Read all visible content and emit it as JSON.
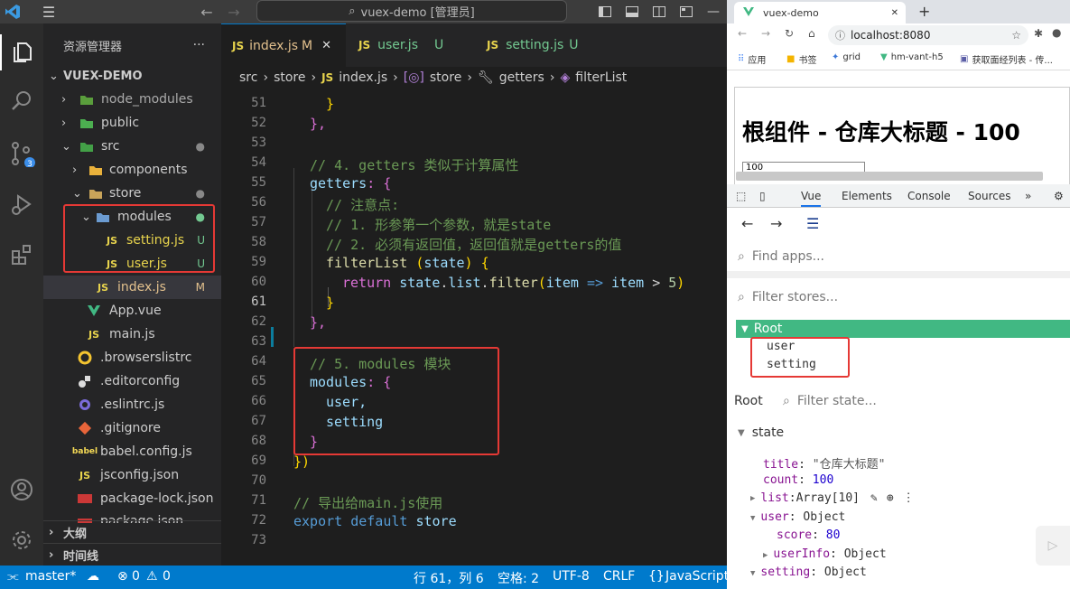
{
  "titlebar": {
    "search_text": "vuex-demo [管理员]"
  },
  "sidebar": {
    "header": "资源管理器",
    "more": "···",
    "root": "VUEX-DEMO",
    "items": [
      {
        "label": "node_modules"
      },
      {
        "label": "public"
      },
      {
        "label": "src"
      },
      {
        "label": "components"
      },
      {
        "label": "store"
      },
      {
        "label": "modules"
      },
      {
        "label": "setting.js",
        "badge": "U",
        "icon_text": "JS"
      },
      {
        "label": "user.js",
        "badge": "U",
        "icon_text": "JS"
      },
      {
        "label": "index.js",
        "badge": "M",
        "icon_text": "JS"
      },
      {
        "label": "App.vue"
      },
      {
        "label": "main.js",
        "icon_text": "JS"
      },
      {
        "label": ".browserslistrc"
      },
      {
        "label": ".editorconfig"
      },
      {
        "label": ".eslintrc.js"
      },
      {
        "label": ".gitignore"
      },
      {
        "label": "babel.config.js",
        "icon_text": "babel"
      },
      {
        "label": "jsconfig.json",
        "icon_text": "JS"
      },
      {
        "label": "package-lock.json"
      },
      {
        "label": "package.json"
      }
    ],
    "outline": "大纲",
    "timeline": "时间线"
  },
  "tabs": [
    {
      "icon_text": "JS",
      "label": "index.js",
      "badge": "M",
      "close": "✕"
    },
    {
      "icon_text": "JS",
      "label": "user.js",
      "badge": "U"
    },
    {
      "icon_text": "JS",
      "label": "setting.js",
      "badge": "U"
    }
  ],
  "breadcrumb": {
    "a": "src",
    "b": "store",
    "c_icon": "JS",
    "c": "index.js",
    "d": "store",
    "e": "getters",
    "f": "filterList"
  },
  "code": {
    "line_numbers": [
      "51",
      "52",
      "53",
      "54",
      "55",
      "56",
      "57",
      "58",
      "59",
      "60",
      "61",
      "62",
      "63",
      "64",
      "65",
      "66",
      "67",
      "68",
      "69",
      "70",
      "71",
      "72",
      "73"
    ],
    "l51": "}",
    "l52": "},",
    "l54": "// 4. getters 类似于计算属性",
    "l55a": "getters",
    "l55b": ": {",
    "l56": "// 注意点:",
    "l57": "// 1. 形参第一个参数，就是state",
    "l58": "// 2. 必须有返回值，返回值就是getters的值",
    "l59a": "filterList",
    "l59b": " (",
    "l59c": "state",
    "l59d": ") {",
    "l60a": "return",
    "l60b": "state",
    "l60c": ".",
    "l60d": "list",
    "l60e": ".",
    "l60f": "filter",
    "l60g": "(",
    "l60h": "item",
    "l60i": "=>",
    "l60j": "item",
    "l60k": ">",
    "l60l": "5",
    "l60m": ")",
    "l61": "}",
    "l62": "},",
    "l64": "// 5. modules 模块",
    "l65a": "modules",
    "l65b": ": {",
    "l66": "user,",
    "l67": "setting",
    "l68": "}",
    "l69": "})",
    "l71": "// 导出给main.js使用",
    "l72a": "export",
    "l72b": "default",
    "l72c": "store"
  },
  "statusbar": {
    "branch": "master*",
    "errors": "0",
    "warnings": "0",
    "position": "行 61，列 6",
    "spaces": "空格: 2",
    "encoding": "UTF-8",
    "eol": "CRLF",
    "language": "JavaScript"
  },
  "browser": {
    "tab_title": "vuex-demo",
    "tab_close": "✕",
    "new_tab": "+",
    "url": "localhost:8080",
    "bookmarks": [
      "应用",
      "书签",
      "grid",
      "hm-vant-h5",
      "获取面经列表 - 传..."
    ],
    "page_heading": "根组件 - 仓库大标题 - 100",
    "page_input_value": "100"
  },
  "devtools": {
    "tabs": [
      "Vue",
      "Elements",
      "Console",
      "Sources",
      "»"
    ],
    "find_apps": "Find apps...",
    "filter_stores": "Filter stores...",
    "root_label": "Root",
    "modules": [
      "user",
      "setting"
    ],
    "state_root": "Root",
    "filter_state": "Filter state...",
    "state_label": "state",
    "rows": [
      {
        "key": "title",
        "value": "\"仓库大标题\""
      },
      {
        "key": "count",
        "value": "100"
      },
      {
        "key": "list",
        "value": "Array[10]"
      },
      {
        "key": "user",
        "value": "Object"
      },
      {
        "key": "score",
        "value": "80"
      },
      {
        "key": "userInfo",
        "value": "Object"
      },
      {
        "key": "setting",
        "value": "Object"
      }
    ]
  },
  "colors": {
    "accent": "#007acc",
    "vue_green": "#41b883",
    "highlight_red": "#e53935"
  }
}
